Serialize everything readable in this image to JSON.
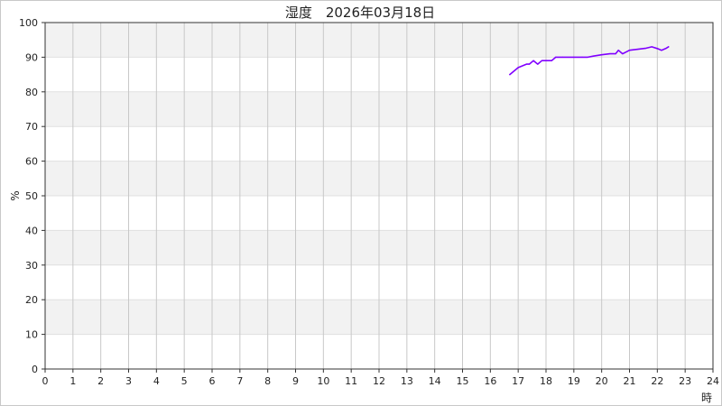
{
  "chart_data": {
    "type": "line",
    "title": "湿度　2026年03月18日",
    "xlabel": "時",
    "ylabel": "%",
    "xlim": [
      0,
      24
    ],
    "ylim": [
      0,
      100
    ],
    "x_ticks": [
      "0",
      "1",
      "2",
      "3",
      "4",
      "5",
      "6",
      "7",
      "8",
      "9",
      "10",
      "11",
      "12",
      "13",
      "14",
      "15",
      "16",
      "17",
      "18",
      "19",
      "20",
      "21",
      "22",
      "23",
      "24"
    ],
    "y_ticks": [
      "0",
      "10",
      "20",
      "30",
      "40",
      "50",
      "60",
      "70",
      "80",
      "90",
      "100"
    ],
    "grid": true,
    "legend": "none",
    "band_colors": [
      "#ffffff",
      "#f2f2f2"
    ],
    "grid_color": "#c8c8c8",
    "series": [
      {
        "color": "#8000ff",
        "x": [
          16.7,
          17.0,
          17.3,
          17.4,
          17.55,
          17.7,
          17.85,
          18.0,
          18.2,
          18.35,
          18.6,
          19.0,
          19.3,
          19.5,
          19.7,
          20.0,
          20.3,
          20.5,
          20.6,
          20.75,
          20.9,
          21.0,
          21.3,
          21.6,
          21.8,
          22.0,
          22.15,
          22.3,
          22.4
        ],
        "y": [
          85,
          87,
          88,
          88,
          89,
          88,
          89,
          89,
          89,
          90,
          90,
          90,
          90,
          90,
          90.3,
          90.7,
          91,
          91,
          92,
          91,
          91.6,
          92,
          92.3,
          92.6,
          93,
          92.5,
          92,
          92.5,
          93
        ]
      }
    ]
  }
}
